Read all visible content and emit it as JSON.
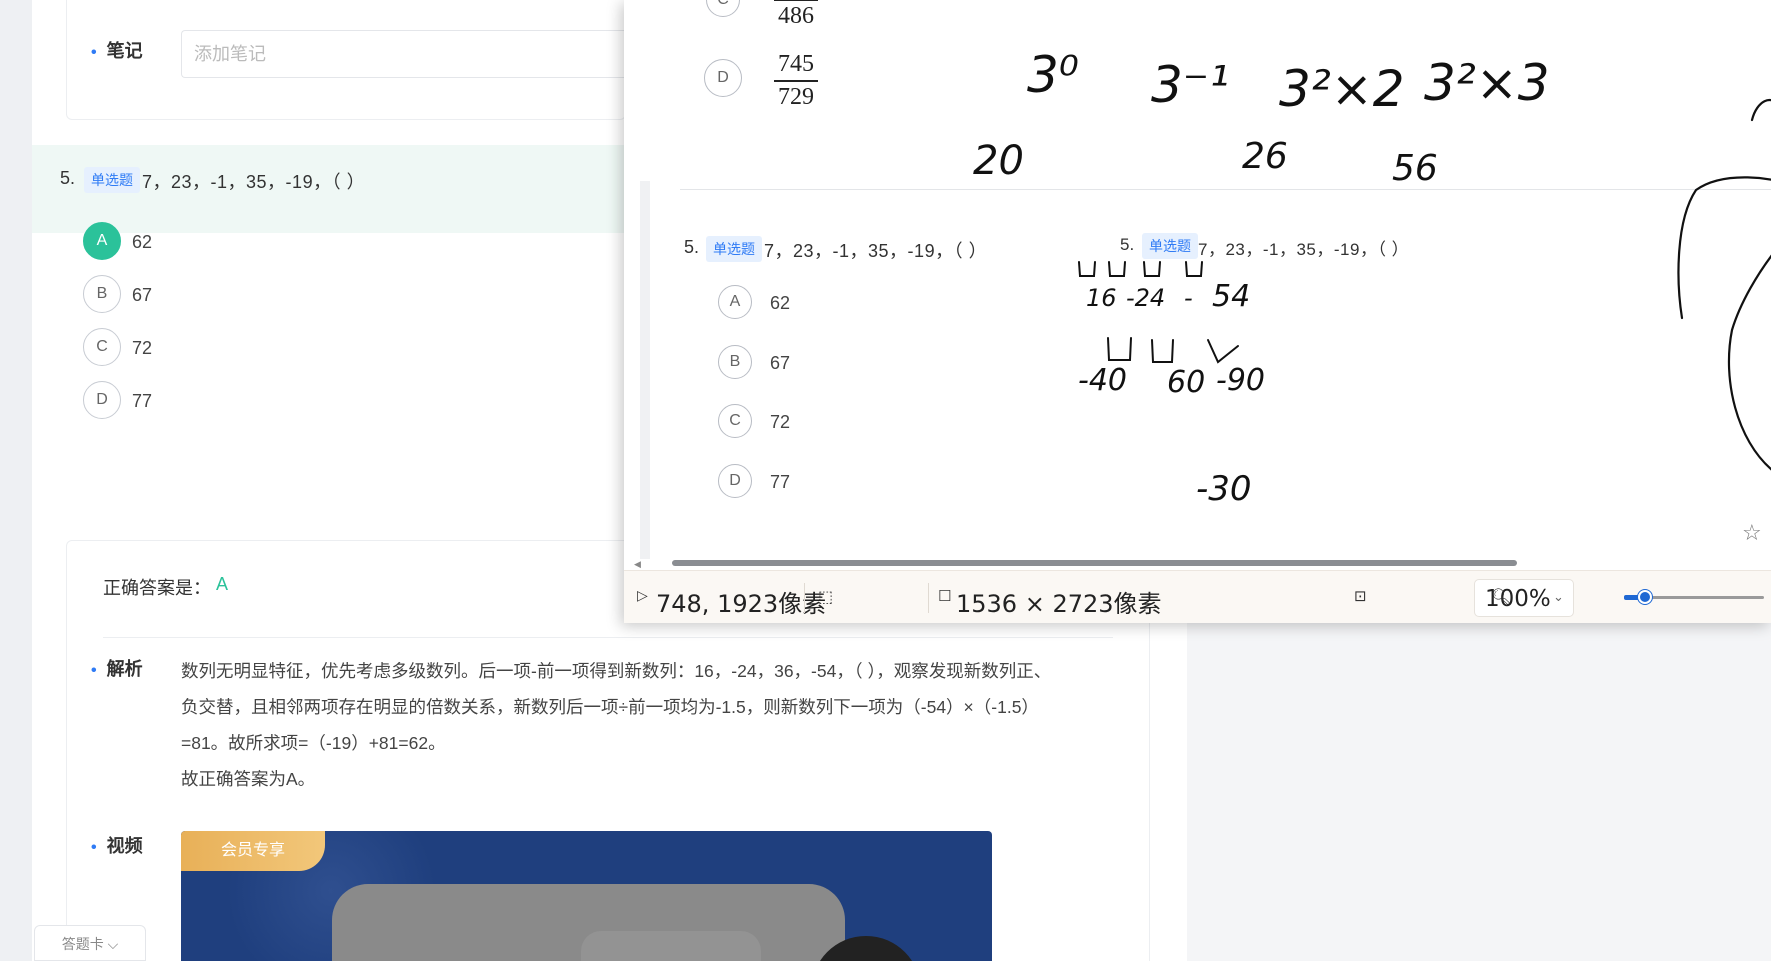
{
  "page": {
    "note": {
      "label": "笔记",
      "placeholder": "添加笔记"
    },
    "question": {
      "number": "5.",
      "type_tag": "单选题",
      "text": "7，23，-1，35，-19，（ ）",
      "options": [
        {
          "letter": "A",
          "value": "62",
          "selected": true
        },
        {
          "letter": "B",
          "value": "67"
        },
        {
          "letter": "C",
          "value": "72"
        },
        {
          "letter": "D",
          "value": "77"
        }
      ]
    },
    "answer": {
      "label": "正确答案是：",
      "value": "A",
      "analysis_label": "解析",
      "analysis_lines": [
        "数列无明显特征，优先考虑多级数列。后一项-前一项得到新数列：16，-24，36，-54，（ ），观察发现新数列正、",
        "负交替，且相邻两项存在明显的倍数关系，新数列后一项÷前一项均为-1.5，则新数列下一项为（-54）×（-1.5）",
        "=81。故所求项=（-19）+81=62。",
        "故正确答案为A。"
      ],
      "video_label": "视频",
      "vip_badge": "会员专享"
    },
    "answer_sheet_button": "答题卡"
  },
  "viewer": {
    "prev_option": {
      "letter": "C",
      "denominator": "486"
    },
    "option_d": {
      "letter": "D",
      "numerator": "745",
      "denominator": "729"
    },
    "question": {
      "number": "5.",
      "type_tag": "单选题",
      "text": "7，23，-1，35，-19，（ ）",
      "options": [
        {
          "letter": "A",
          "value": "62"
        },
        {
          "letter": "B",
          "value": "67"
        },
        {
          "letter": "C",
          "value": "72"
        },
        {
          "letter": "D",
          "value": "77"
        }
      ]
    },
    "question_copy": {
      "number": "5.",
      "type_tag": "单选题",
      "text": "7，23，-1，35，-19，（ ）"
    },
    "handwriting": {
      "powers": [
        "3⁰",
        "3⁻¹",
        "3²×2",
        "3²×3"
      ],
      "diffs_top": [
        "20",
        "26",
        "56"
      ],
      "diffs_row": [
        "16",
        "-24",
        "-",
        "54"
      ],
      "diffs_second": [
        "-40",
        "60",
        "-90"
      ],
      "bottom": "-30"
    },
    "status": {
      "cursor_pos": "748, 1923像素",
      "image_size": "1536 × 2723像素",
      "zoom": "100%"
    }
  }
}
